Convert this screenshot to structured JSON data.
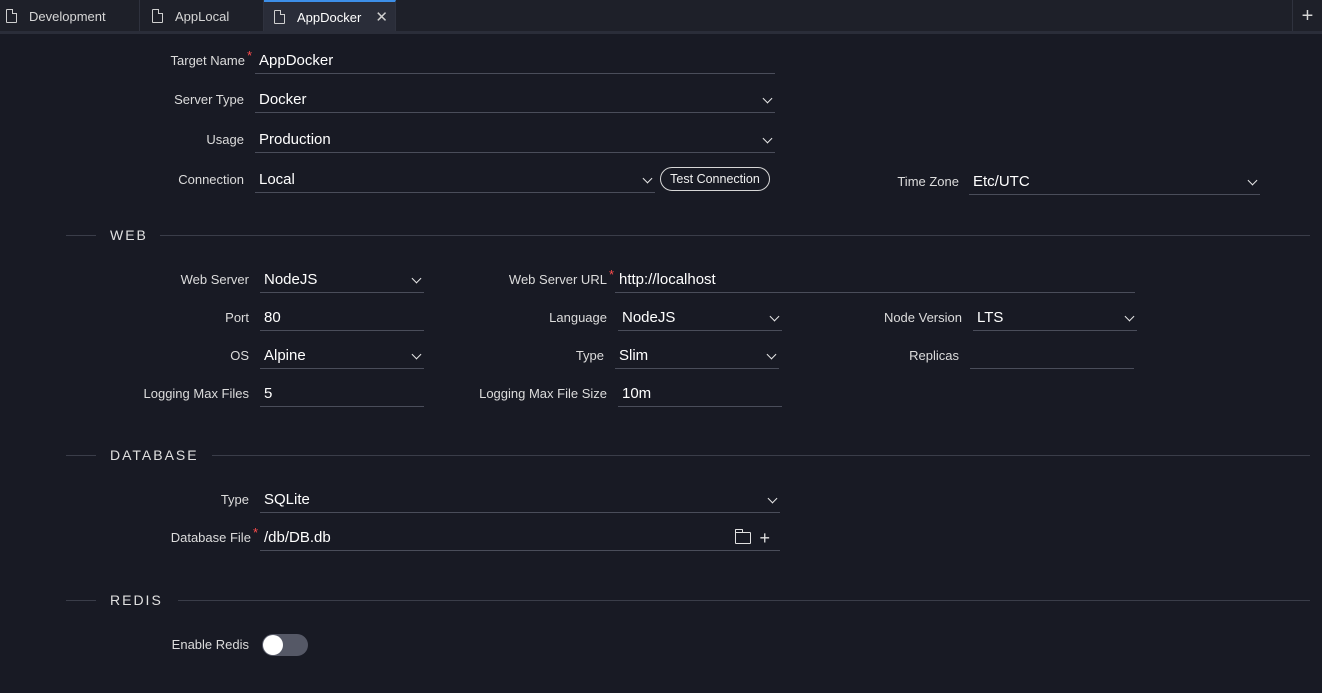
{
  "tabs": [
    {
      "label": "Development"
    },
    {
      "label": "AppLocal"
    },
    {
      "label": "AppDocker"
    }
  ],
  "general": {
    "target_name_label": "Target Name",
    "target_name_value": "AppDocker",
    "server_type_label": "Server Type",
    "server_type_value": "Docker",
    "usage_label": "Usage",
    "usage_value": "Production",
    "connection_label": "Connection",
    "connection_value": "Local",
    "test_connection_label": "Test Connection",
    "time_zone_label": "Time Zone",
    "time_zone_value": "Etc/UTC",
    "required_mark": "*"
  },
  "web": {
    "title": "WEB",
    "web_server_label": "Web Server",
    "web_server_value": "NodeJS",
    "web_server_url_label": "Web Server URL",
    "web_server_url_value": "http://localhost",
    "port_label": "Port",
    "port_value": "80",
    "language_label": "Language",
    "language_value": "NodeJS",
    "node_version_label": "Node Version",
    "node_version_value": "LTS",
    "os_label": "OS",
    "os_value": "Alpine",
    "type_label": "Type",
    "type_value": "Slim",
    "replicas_label": "Replicas",
    "replicas_value": "",
    "logging_max_files_label": "Logging Max Files",
    "logging_max_files_value": "5",
    "logging_max_file_size_label": "Logging Max File Size",
    "logging_max_file_size_value": "10m"
  },
  "database": {
    "title": "DATABASE",
    "type_label": "Type",
    "type_value": "SQLite",
    "file_label": "Database File",
    "file_value": "/db/DB.db"
  },
  "redis": {
    "title": "REDIS",
    "enable_label": "Enable Redis",
    "enabled": false
  },
  "icons": {
    "tab_icon": "document-icon",
    "close": "close-icon",
    "add_tab": "plus-icon",
    "dropdown": "chevron-down-icon",
    "browse": "folder-open-icon",
    "add_file": "plus-icon"
  },
  "colors": {
    "background": "#181a24",
    "active_tab_accent": "#3d8fe8",
    "required": "#ff4d4d"
  }
}
